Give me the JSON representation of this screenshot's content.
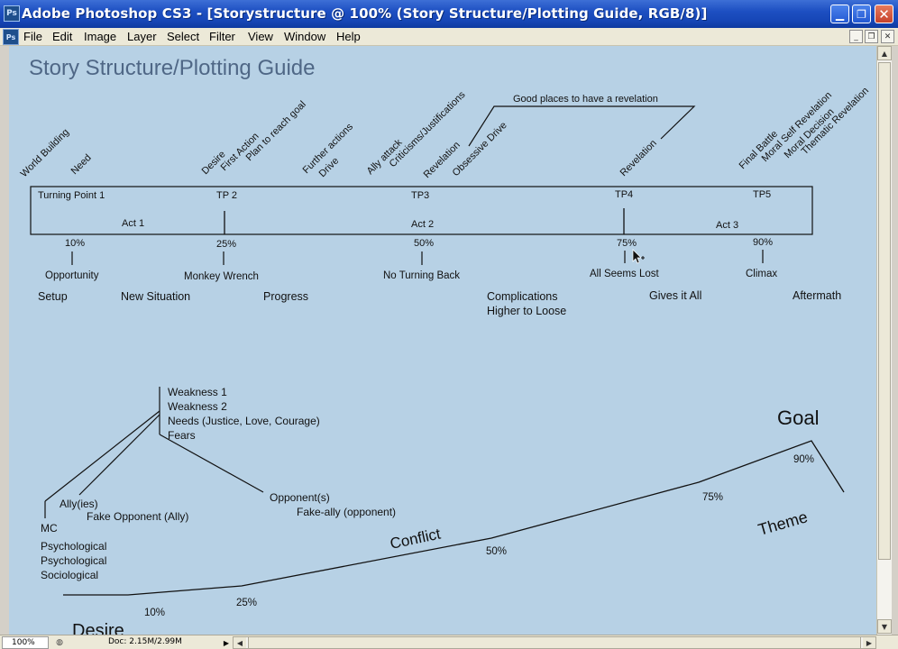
{
  "window": {
    "app_icon": "Ps",
    "title": "Adobe Photoshop CS3 - [Storystructure @ 100% (Story Structure/Plotting Guide, RGB/8)]",
    "minimize": "▁",
    "restore": "❐",
    "close": "✕"
  },
  "menubar": {
    "doc_icon": "Ps",
    "items": [
      "File",
      "Edit",
      "Image",
      "Layer",
      "Select",
      "Filter",
      "View",
      "Window",
      "Help"
    ]
  },
  "document": {
    "title": "Story Structure/Plotting Guide",
    "diagonal_labels": [
      "World Building",
      "Need",
      "Desire",
      "First Action",
      "Plan to reach goal",
      "Further actions",
      "Drive",
      "Ally attack",
      "Criticisms/Justifications",
      "Revelation",
      "Obsessive Drive",
      "Revelation",
      "Final Battle",
      "Moral Self Revelation",
      "Moral Decision",
      "Thematic Revelation"
    ],
    "revelation_note": "Good places to have a revelation",
    "turning_points": [
      "Turning Point 1",
      "TP 2",
      "TP3",
      "TP4",
      "TP5"
    ],
    "acts": [
      "Act 1",
      "Act 2",
      "Act 3"
    ],
    "percent_markers": [
      "10%",
      "25%",
      "50%",
      "75%",
      "90%"
    ],
    "marker_labels": [
      "Opportunity",
      "Monkey Wrench",
      "No Turning Back",
      "All Seems Lost",
      "Climax"
    ],
    "stages": [
      "Setup",
      "New Situation",
      "Progress",
      "Complications",
      "Higher to Loose",
      "Gives it All",
      "Aftermath"
    ],
    "character_traits": [
      "Weakness 1",
      "Weakness 2",
      "Needs (Justice, Love, Courage)",
      "Fears"
    ],
    "characters": [
      "Ally(ies)",
      "Fake Opponent (Ally)",
      "MC",
      "Opponent(s)",
      "Fake-ally (opponent)"
    ],
    "mc_dimensions": [
      "Psychological",
      "Psychological",
      "Sociological"
    ],
    "curve_labels": [
      "Goal",
      "Conflict",
      "Theme",
      "Desire"
    ],
    "curve_percents": [
      "10%",
      "25%",
      "50%",
      "75%",
      "90%"
    ]
  },
  "statusbar": {
    "zoom": "100%",
    "doc_size": "Doc: 2.15M/2.99M"
  },
  "colors": {
    "canvas": "#b7d1e5",
    "title_blue": "#1d4fc2",
    "heading_text": "#4f6786"
  }
}
